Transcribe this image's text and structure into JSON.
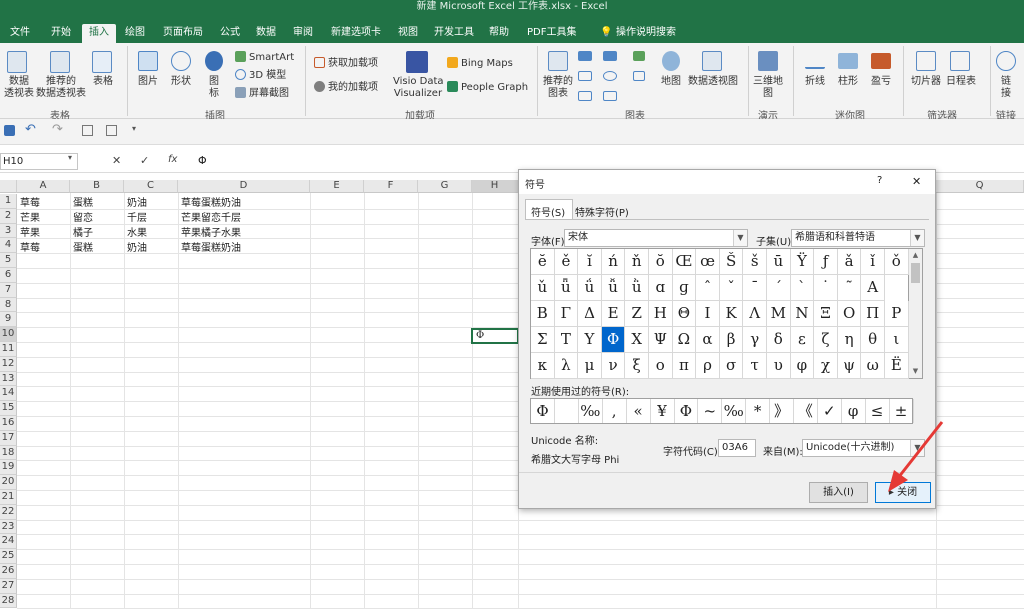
{
  "app": {
    "title": "新建 Microsoft Excel 工作表.xlsx  -  Excel"
  },
  "tabs": [
    "文件",
    "开始",
    "插入",
    "绘图",
    "页面布局",
    "公式",
    "数据",
    "审阅",
    "新建选项卡",
    "视图",
    "开发工具",
    "帮助",
    "PDF工具集",
    "操作说明搜索"
  ],
  "ribbon": {
    "pivot": "数据\n透视表",
    "rec_pivot": "推荐的\n数据透视表",
    "table": "表格",
    "g_table": "表格",
    "picture": "图片",
    "shape": "形状",
    "icon": "图\n标",
    "smartart": "SmartArt",
    "model3d": "3D 模型",
    "screenshot": "屏幕截图",
    "g_illus": "插图",
    "get_addins": "获取加载项",
    "my_addins": "我的加载项",
    "visio": "Visio Data\nVisualizer",
    "bing": "Bing Maps",
    "people": "People Graph",
    "g_addins": "加载项",
    "rec_charts": "推荐的\n图表",
    "map": "地图",
    "pivotchart": "数据透视图",
    "g_charts": "图表",
    "map3d": "三维地\n图",
    "g_tour": "演示",
    "line": "折线",
    "column": "柱形",
    "winloss": "盈亏",
    "g_spark": "迷你图",
    "slicer": "切片器",
    "timeline": "日程表",
    "g_filter": "筛选器",
    "link": "链\n接",
    "g_link": "链接"
  },
  "formula": {
    "namebox": "H10",
    "fx": "fx",
    "cancel": "✕",
    "enter": "✓",
    "value": "Φ"
  },
  "sheet": {
    "columns": [
      "A",
      "B",
      "C",
      "D",
      "E",
      "F",
      "G",
      "H",
      "Q"
    ],
    "rows": [
      "1",
      "2",
      "3",
      "4",
      "5",
      "6",
      "7",
      "8",
      "9",
      "10",
      "11",
      "12",
      "13",
      "14",
      "15",
      "16",
      "17",
      "18",
      "19",
      "20",
      "21",
      "22",
      "23",
      "24",
      "25",
      "26",
      "27",
      "28"
    ],
    "data": [
      [
        "草莓",
        "蛋糕",
        "奶油",
        "草莓蛋糕奶油"
      ],
      [
        "芒果",
        "留恋",
        "千层",
        "芒果留恋千层"
      ],
      [
        "苹果",
        "橘子",
        "水果",
        "苹果橘子水果"
      ],
      [
        "草莓",
        "蛋糕",
        "奶油",
        "草莓蛋糕奶油"
      ]
    ],
    "active_cell_value": "Φ"
  },
  "dialog": {
    "title": "符号",
    "help": "?",
    "close": "✕",
    "tab_symbols": "符号(S)",
    "tab_special": "特殊字符(P)",
    "font_label": "字体(F):",
    "font_value": "宋体",
    "subset_label": "子集(U):",
    "subset_value": "希腊语和科普特语",
    "symbols": [
      [
        "ĕ",
        "ě",
        "ĭ",
        "ń",
        "ň",
        "ŏ",
        "Œ",
        "œ",
        "Š",
        "š",
        "ū",
        "Ÿ",
        "ƒ",
        "ǎ",
        "ǐ",
        "ǒ"
      ],
      [
        "ǔ",
        "ǖ",
        "ǘ",
        "ǚ",
        "ǜ",
        "ɑ",
        "ɡ",
        "ˆ",
        "ˇ",
        "ˉ",
        "ˊ",
        "ˋ",
        "˙",
        "˜",
        "Α"
      ],
      [
        "Β",
        "Γ",
        "Δ",
        "Ε",
        "Ζ",
        "Η",
        "Θ",
        "Ι",
        "Κ",
        "Λ",
        "Μ",
        "Ν",
        "Ξ",
        "Ο",
        "Π",
        "Ρ"
      ],
      [
        "Σ",
        "Τ",
        "Υ",
        "Φ",
        "Χ",
        "Ψ",
        "Ω",
        "α",
        "β",
        "γ",
        "δ",
        "ε",
        "ζ",
        "η",
        "θ",
        "ι"
      ],
      [
        "κ",
        "λ",
        "μ",
        "ν",
        "ξ",
        "ο",
        "π",
        "ρ",
        "σ",
        "τ",
        "υ",
        "φ",
        "χ",
        "ψ",
        "ω",
        "Ё"
      ]
    ],
    "selected": "Φ",
    "recent_label": "近期使用过的符号(R):",
    "recent": [
      "Φ",
      "",
      "‰",
      ",",
      "«",
      "¥",
      "Φ",
      "~",
      "‰",
      "*",
      "》",
      "《",
      "✓",
      "φ",
      "≤",
      "±"
    ],
    "unicode_label": "Unicode 名称:",
    "unicode_name": "希腊文大写字母 Phi",
    "code_label": "字符代码(C):",
    "code_value": "03A6",
    "from_label": "来自(M):",
    "from_value": "Unicode(十六进制)",
    "insert_btn": "插入(I)",
    "close_btn": "关闭"
  },
  "colors": {
    "excel_green": "#217346",
    "selection_blue": "#0066cc",
    "arrow_red": "#e53935"
  }
}
